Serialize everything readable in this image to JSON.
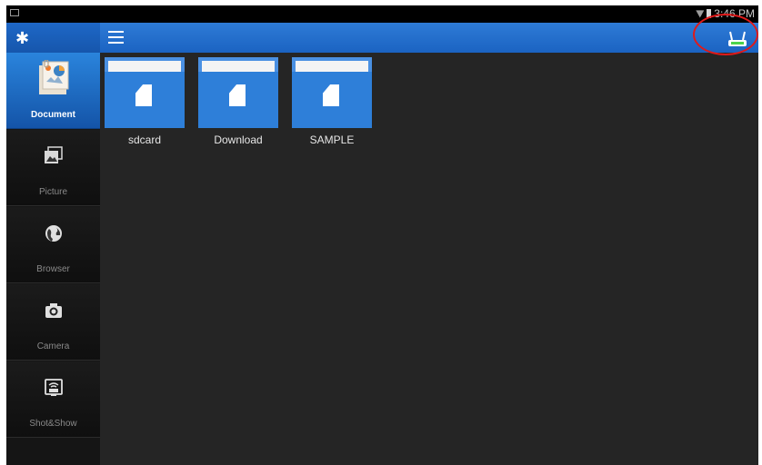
{
  "status_bar": {
    "time": "3:46 PM",
    "icons": [
      "notification-icon",
      "wifi-icon",
      "battery-icon"
    ]
  },
  "toolbar": {
    "settings_icon": "gear-icon",
    "menu_icon": "hamburger-menu-icon",
    "connect_icon": "router-icon",
    "accent_color": "#1b63c2",
    "highlight_color": "#e01a1a"
  },
  "sidebar": {
    "items": [
      {
        "label": "Document",
        "icon": "document-icon",
        "active": true
      },
      {
        "label": "Picture",
        "icon": "picture-icon",
        "active": false
      },
      {
        "label": "Browser",
        "icon": "globe-icon",
        "active": false
      },
      {
        "label": "Camera",
        "icon": "camera-icon",
        "active": false
      },
      {
        "label": "Shot&Show",
        "icon": "screen-share-icon",
        "active": false
      }
    ]
  },
  "folders": [
    {
      "name": "sdcard",
      "icon": "folder-icon"
    },
    {
      "name": "Download",
      "icon": "folder-icon"
    },
    {
      "name": "SAMPLE",
      "icon": "folder-icon"
    }
  ]
}
